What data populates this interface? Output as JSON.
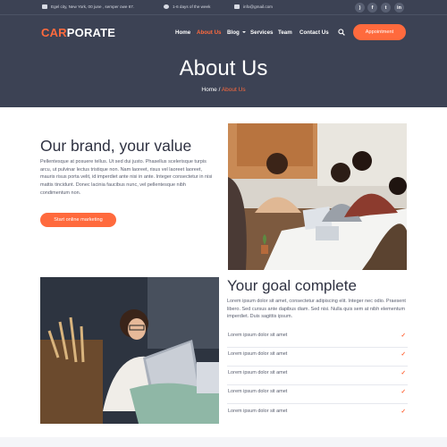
{
  "topbar": {
    "address": "Egel city, New York, 00 june , semper owe 67.",
    "hours": "1-6 days of the week",
    "email": "info@gmail.com",
    "social": [
      "rss-icon",
      "facebook-icon",
      "twitter-icon",
      "linkedin-icon"
    ],
    "social_labels": [
      ")",
      "f",
      "t",
      "in"
    ]
  },
  "header": {
    "logo_accent": "CAR",
    "logo_rest": "PORATE",
    "nav": [
      "Home",
      "About Us",
      "Blog",
      "Services",
      "Team",
      "Contact Us"
    ],
    "active_nav": "About Us",
    "appointment_label": "Appointment"
  },
  "hero": {
    "title": "About Us",
    "breadcrumb_home": "Home",
    "breadcrumb_sep": "/",
    "breadcrumb_current": "About Us"
  },
  "brand": {
    "title": "Our brand, your value",
    "text": "Pellentesque at posuere tellus. Ut sed dui justo. Phasellus scelerisque turpis arcu, ut pulvinar lectus tristique non. Nam laoreet, risus vel laoreet laoreet, mauris risus porta velit, id imperdiet ante nisi in ante. Integer consectetur in nisi mattis tincidunt. Donec lacinia faucibus nunc, vel pellentesque nibh condimentum non.",
    "button": "Start online marketing"
  },
  "goal": {
    "title": "Your goal complete",
    "text": "Lorem ipsum dolor sit amet, consectetur adipiscing elit. Integer nec odio. Praesent libero. Sed cursus ante dapibus diam. Sed nisi. Nulla quis sem at nibh elementum imperdiet. Duis sagittis ipsum.",
    "items": [
      "Lorem ipsum dolor sit amet",
      "Lorem ipsum dolor sit amet",
      "Lorem ipsum dolor sit amet",
      "Lorem ipsum dolor sit amet",
      "Lorem ipsum dolor sit amet"
    ],
    "check": "✓"
  },
  "colors": {
    "accent": "#ff6a3d",
    "header_bg": "#3c4254",
    "text": "#575c6d"
  }
}
